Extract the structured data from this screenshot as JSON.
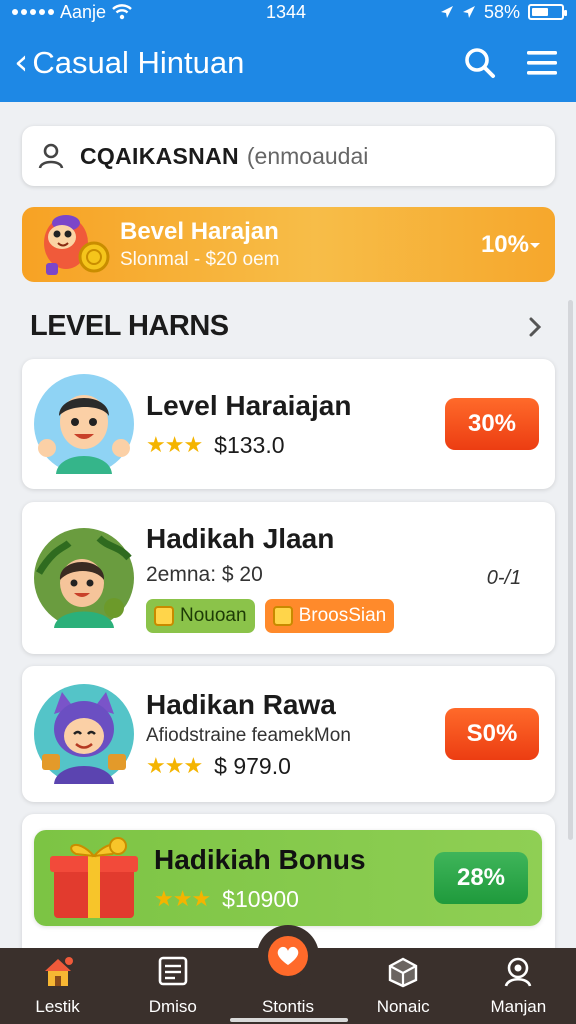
{
  "status": {
    "carrier": "Aanje",
    "time": "1344",
    "battery": "58%",
    "battery_level": 0.58
  },
  "header": {
    "title": "Casual Hintuan"
  },
  "search": {
    "query": "CQAIKASNAN",
    "hint": "(enmoaudai"
  },
  "banner": {
    "title": "Bevel Harajan",
    "subtitle": "Slonmal - $20 oem",
    "percent": "10%"
  },
  "section": {
    "title": "LEVEL HARNS"
  },
  "cards": [
    {
      "name": "Level Haraiajan",
      "stars": "★★★",
      "price": "$133.0",
      "badge": "30%"
    },
    {
      "name": "Hadikah Jlaan",
      "sub": "2emna: $ 20",
      "tag1": "Nouoan",
      "tag2": "BroosSian",
      "side": "0-/1"
    },
    {
      "name": "Hadikan Rawa",
      "sub": "Afiodstraine feamekMon",
      "stars": "★★★",
      "price": "$ 979.0",
      "badge": "S0%"
    },
    {
      "name": "Hadikiah Bonus",
      "stars": "★★★",
      "price": "$10900",
      "badge": "28%"
    }
  ],
  "nav": [
    "Lestik",
    "Dmiso",
    "Stontis",
    "Nonaic",
    "Manjan"
  ],
  "colors": {
    "header": "#1e88e5",
    "banner": "#f7a224",
    "badge_red": "#ef4a18",
    "badge_green": "#2aa84a",
    "bonus": "#86c94d",
    "nav": "#3a302c"
  }
}
